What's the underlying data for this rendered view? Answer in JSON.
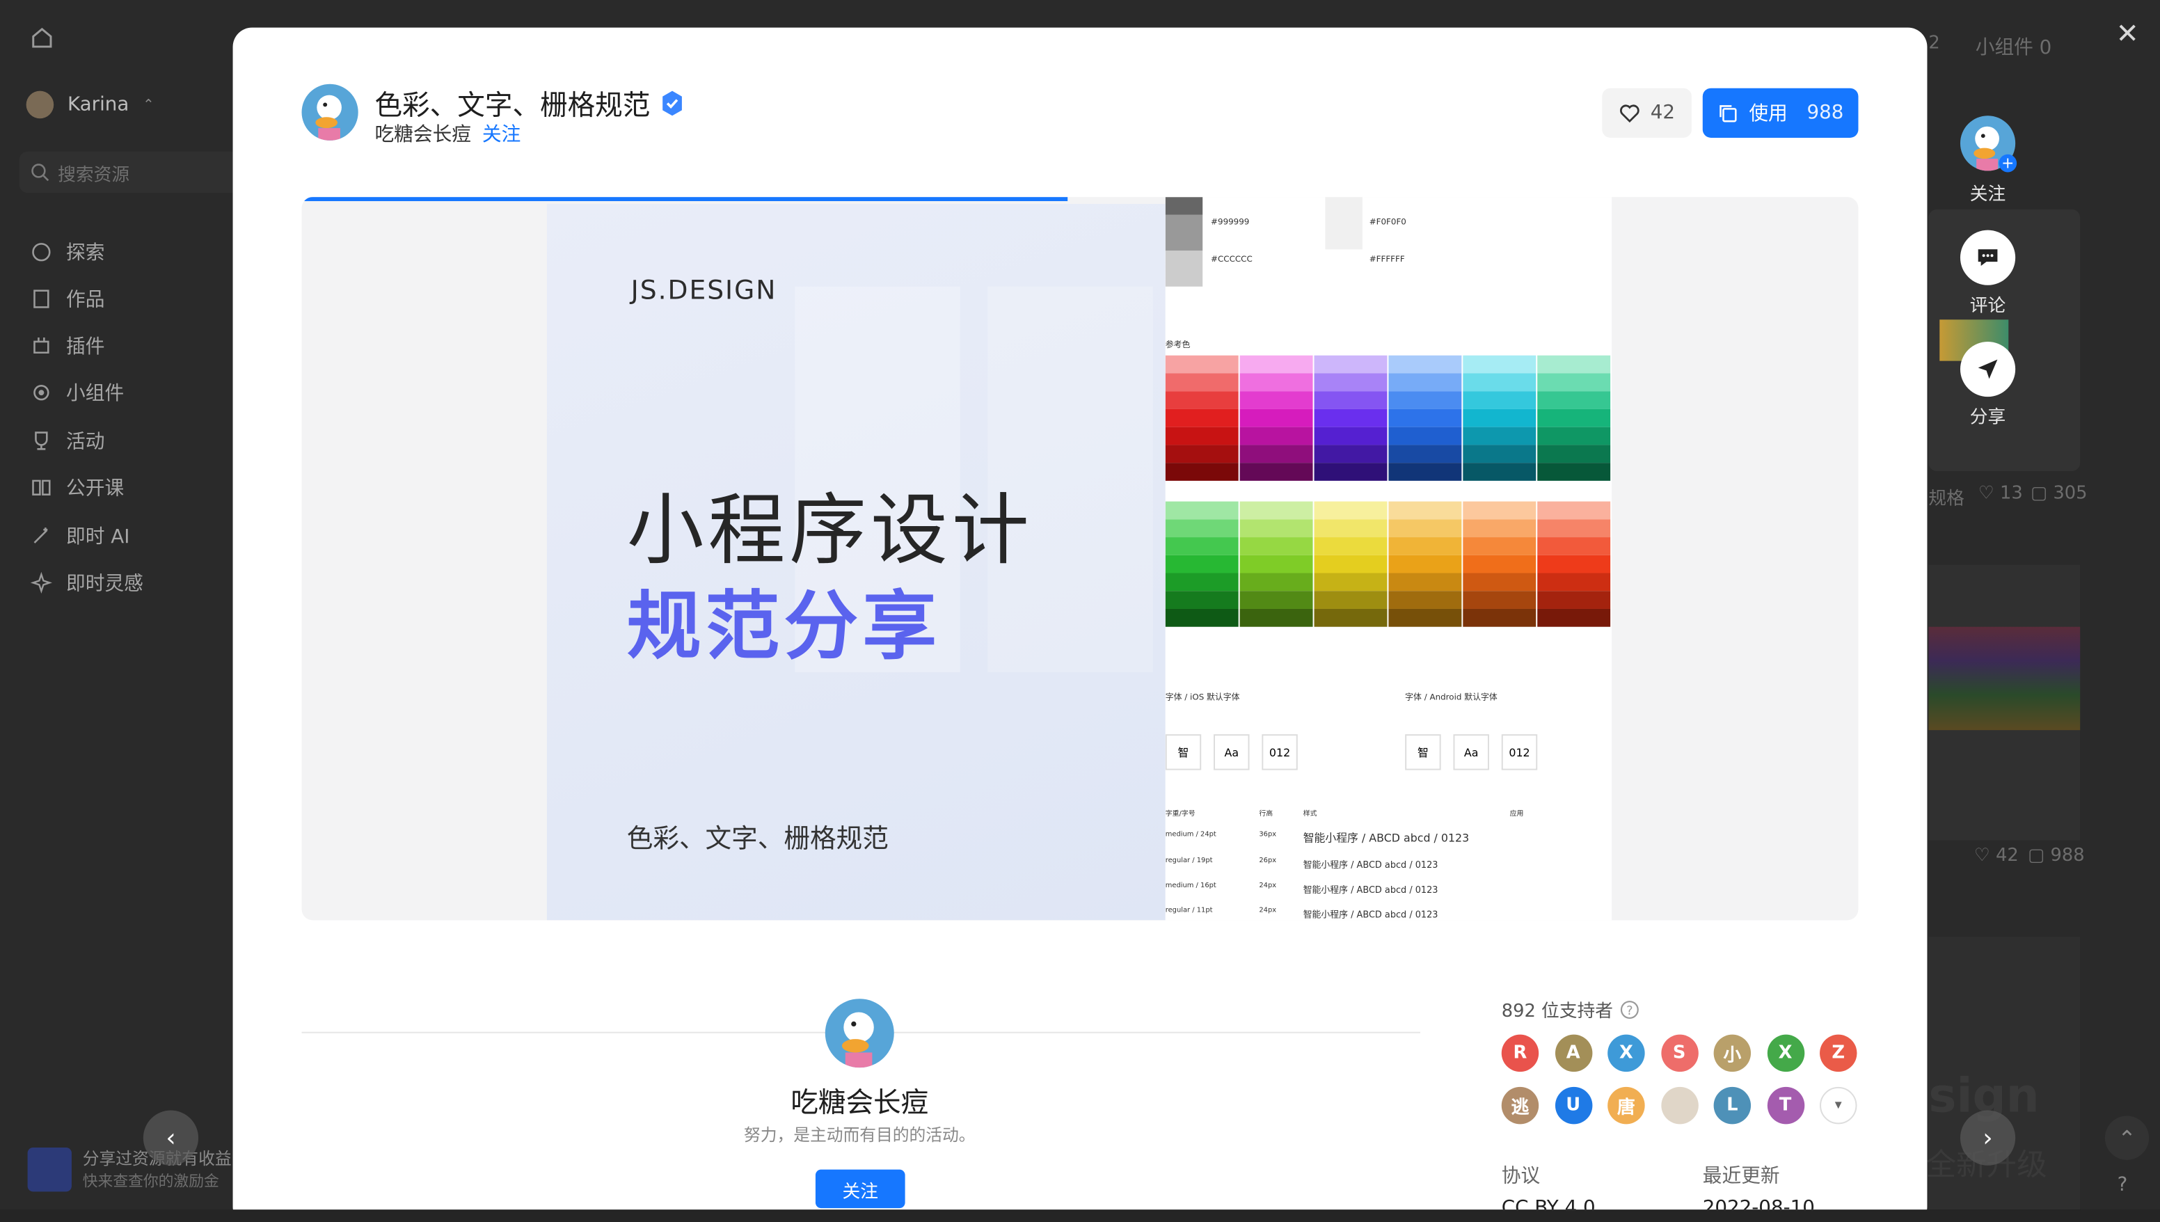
{
  "app": {
    "user": "Karina",
    "search_placeholder": "搜索资源"
  },
  "sidebar": {
    "items": [
      {
        "label": "探索"
      },
      {
        "label": "作品"
      },
      {
        "label": "插件"
      },
      {
        "label": "小组件"
      },
      {
        "label": "活动"
      },
      {
        "label": "公开课"
      },
      {
        "label": "即时 AI"
      },
      {
        "label": "即时灵感"
      }
    ],
    "promo": {
      "line1": "分享过资源就有收益",
      "line2": "快来查查你的激励金"
    }
  },
  "bg_right": {
    "tab_widget": "小组件 0",
    "tab_2": "2",
    "stats1_likes": "13",
    "stats1_comments": "305",
    "stats2_likes": "42",
    "stats2_comments": "988",
    "label_ge": "规格",
    "big_text": "sign",
    "sub_text": "全新升级"
  },
  "modal": {
    "title": "色彩、文字、栅格规范",
    "author": "吃糖会长痘",
    "follow": "关注",
    "likes": "42",
    "use_label": "使用",
    "use_count": "988",
    "progress": 0.49
  },
  "cover": {
    "brand": "JS.DESIGN",
    "headline": "小程序设计",
    "headline2": "规范分享",
    "subtitle": "色彩、文字、栅格规范"
  },
  "spec": {
    "gray1": "#999999",
    "gray2": "#CCCCCC",
    "light1": "#F0F0F0",
    "light2": "#FFFFFF",
    "ref_label": "参考色",
    "ios_font": "字体 / iOS 默认字体",
    "android_font": "字体 / Android 默认字体",
    "glyph_zh": "智",
    "glyph_aa": "Aa",
    "glyph_num": "012",
    "table_headers": [
      "字重/字号",
      "行高",
      "样式",
      "应用"
    ],
    "table_rows": [
      [
        "medium / 24pt",
        "36px",
        "智能小程序 / ABCD abcd / 0123"
      ],
      [
        "regular / 19pt",
        "26px",
        "智能小程序 / ABCD abcd / 0123"
      ],
      [
        "medium / 16pt",
        "24px",
        "智能小程序 / ABCD abcd / 0123"
      ],
      [
        "regular / 11pt",
        "24px",
        "智能小程序 / ABCD abcd / 0123"
      ]
    ]
  },
  "profile": {
    "name": "吃糖会长痘",
    "desc": "努力，是主动而有目的的活动。",
    "follow": "关注"
  },
  "supporters": {
    "count_text": "892 位支持者",
    "avatars": [
      {
        "letter": "R",
        "color": "#e9534c"
      },
      {
        "letter": "A",
        "color": "#a38f58"
      },
      {
        "letter": "X",
        "color": "#3e9ad8"
      },
      {
        "letter": "S",
        "color": "#ee6d6a"
      },
      {
        "letter": "小",
        "color": "#b9a06a"
      },
      {
        "letter": "X",
        "color": "#44a949"
      },
      {
        "letter": "Z",
        "color": "#ea5b48"
      },
      {
        "letter": "逃",
        "color": "#b28d6a"
      },
      {
        "letter": "U",
        "color": "#1f7ae6"
      },
      {
        "letter": "唐",
        "color": "#f1ae52"
      },
      {
        "letter": "",
        "color": "#e0d6c8"
      },
      {
        "letter": "L",
        "color": "#4e91b8"
      },
      {
        "letter": "T",
        "color": "#a45cae"
      }
    ]
  },
  "meta": {
    "license_label": "协议",
    "license": "CC BY 4.0",
    "updated_label": "最近更新",
    "updated": "2022-08-10"
  },
  "actions": {
    "follow": "关注",
    "comment": "评论",
    "share": "分享"
  }
}
